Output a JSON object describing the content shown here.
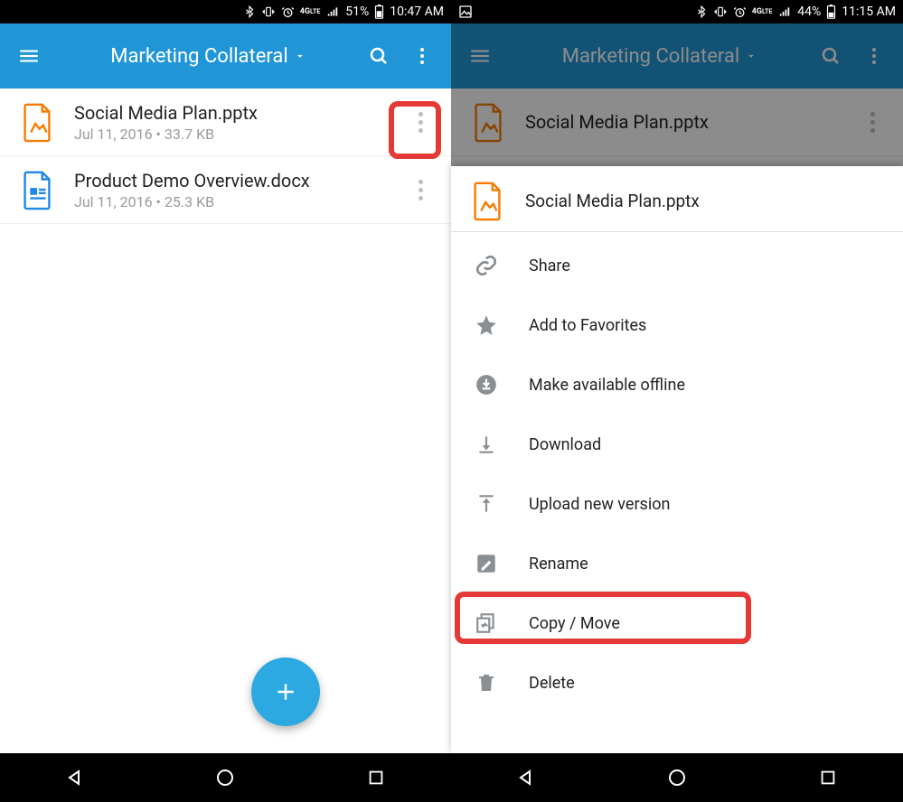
{
  "left": {
    "status": {
      "battery": "51%",
      "time": "10:47 AM"
    },
    "appbar": {
      "title": "Marketing Collateral"
    },
    "files": [
      {
        "name": "Social Media Plan.pptx",
        "meta": "Jul 11, 2016  • 33.7 KB",
        "icon": "pptx"
      },
      {
        "name": "Product Demo Overview.docx",
        "meta": "Jul 11, 2016  • 25.3 KB",
        "icon": "docx"
      }
    ]
  },
  "right": {
    "status": {
      "battery": "44%",
      "time": "11:15 AM"
    },
    "appbar": {
      "title": "Marketing Collateral"
    },
    "peek_file": {
      "name": "Social Media Plan.pptx"
    },
    "sheet": {
      "filename": "Social Media Plan.pptx",
      "items": [
        {
          "icon": "link",
          "label": "Share"
        },
        {
          "icon": "star",
          "label": "Add to Favorites"
        },
        {
          "icon": "offline",
          "label": "Make available offline"
        },
        {
          "icon": "download",
          "label": "Download"
        },
        {
          "icon": "upload",
          "label": "Upload new version"
        },
        {
          "icon": "rename",
          "label": "Rename"
        },
        {
          "icon": "copy",
          "label": "Copy / Move"
        },
        {
          "icon": "delete",
          "label": "Delete"
        }
      ]
    }
  }
}
